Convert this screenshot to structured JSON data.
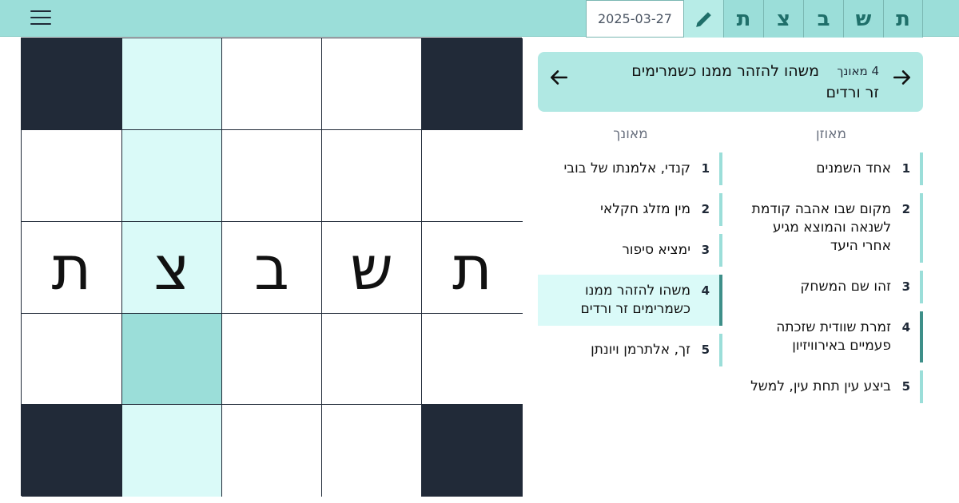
{
  "toolbar": {
    "letters": [
      "ת",
      "ש",
      "ב",
      "צ",
      "ת"
    ],
    "date": "2025-03-27",
    "edit_icon": "pencil-icon",
    "menu_icon": "hamburger-menu-icon"
  },
  "grid": {
    "rows": [
      [
        {
          "type": "black",
          "letter": ""
        },
        {
          "type": "highlight",
          "letter": ""
        },
        {
          "type": "white",
          "letter": ""
        },
        {
          "type": "white",
          "letter": ""
        },
        {
          "type": "black",
          "letter": ""
        }
      ],
      [
        {
          "type": "white",
          "letter": ""
        },
        {
          "type": "highlight",
          "letter": ""
        },
        {
          "type": "white",
          "letter": ""
        },
        {
          "type": "white",
          "letter": ""
        },
        {
          "type": "white",
          "letter": ""
        }
      ],
      [
        {
          "type": "white",
          "letter": "ת"
        },
        {
          "type": "highlight",
          "letter": "צ"
        },
        {
          "type": "white",
          "letter": "ב"
        },
        {
          "type": "white",
          "letter": "ש"
        },
        {
          "type": "white",
          "letter": "ת"
        }
      ],
      [
        {
          "type": "white",
          "letter": ""
        },
        {
          "type": "active",
          "letter": ""
        },
        {
          "type": "white",
          "letter": ""
        },
        {
          "type": "white",
          "letter": ""
        },
        {
          "type": "white",
          "letter": ""
        }
      ],
      [
        {
          "type": "black",
          "letter": ""
        },
        {
          "type": "highlight",
          "letter": ""
        },
        {
          "type": "white",
          "letter": ""
        },
        {
          "type": "white",
          "letter": ""
        },
        {
          "type": "black",
          "letter": ""
        }
      ]
    ]
  },
  "current_clue": {
    "number": "4 מאונך",
    "text": "משהו להזהר ממנו כשמרימים זר ורדים"
  },
  "across": {
    "header": "מאוזן",
    "clues": [
      {
        "num": "1",
        "text": "אחד השמנים"
      },
      {
        "num": "2",
        "text": "מקום שבו אהבה קודמת לשנאה והמוצא מגיע אחרי היעד"
      },
      {
        "num": "3",
        "text": "זהו שם המשחק"
      },
      {
        "num": "4",
        "text": "זמרת שוודית שזכתה פעמיים באירוויזיון"
      },
      {
        "num": "5",
        "text": "ביצע עין תחת עין, למשל"
      }
    ]
  },
  "down": {
    "header": "מאונך",
    "clues": [
      {
        "num": "1",
        "text": "קנדי, אלמנתו של בובי"
      },
      {
        "num": "2",
        "text": "מין מזלג חקלאי"
      },
      {
        "num": "3",
        "text": "ימציא סיפור"
      },
      {
        "num": "4",
        "text": "משהו להזהר ממנו כשמרימים זר ורדים"
      },
      {
        "num": "5",
        "text": "זך, אלתרמן ויונתן"
      }
    ]
  },
  "colors": {
    "accent": "#9bded9",
    "highlight": "#dafaf8",
    "black_cell": "#212a38",
    "marker": "#3e8f89"
  }
}
